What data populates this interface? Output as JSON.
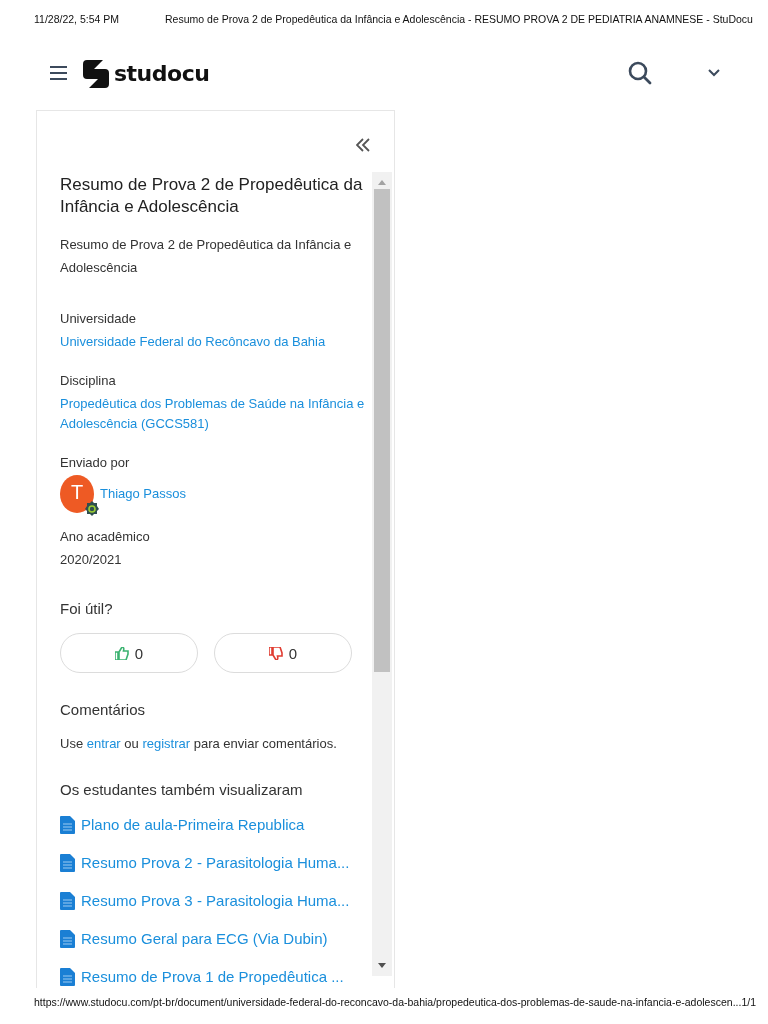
{
  "print_header": {
    "date": "11/28/22, 5:54 PM",
    "title": "Resumo de Prova 2 de Propedêutica da Infância e Adolescência - RESUMO PROVA 2 DE PEDIATRIA ANAMNESE - StuDocu"
  },
  "nav": {
    "logo": "studocu"
  },
  "document": {
    "title": "Resumo de Prova 2 de Propedêutica da Infância e Adolescência",
    "description": "Resumo de Prova 2 de Propedêutica da Infância e Adolescência",
    "fields": [
      {
        "label": "Universidade",
        "value": "Universidade Federal do Recôncavo da Bahia",
        "kind": "link"
      },
      {
        "label": "Disciplina",
        "value": "Propedêutica dos Problemas de Saúde na Infância e Adolescência (GCCS581)",
        "kind": "link"
      },
      {
        "label": "Enviado por",
        "value": "Thiago Passos",
        "kind": "user",
        "avatar_letter": "T"
      },
      {
        "label": "Ano acadêmico",
        "value": "2020/2021",
        "kind": "text"
      }
    ]
  },
  "feedback": {
    "question": "Foi útil?",
    "likes": "0",
    "dislikes": "0"
  },
  "comments": {
    "heading": "Comentários",
    "prompt": [
      {
        "text": "Use ",
        "kind": "text"
      },
      {
        "text": "entrar",
        "kind": "link"
      },
      {
        "text": " ou ",
        "kind": "text"
      },
      {
        "text": "registrar",
        "kind": "link"
      },
      {
        "text": " para enviar comentários.",
        "kind": "text"
      }
    ]
  },
  "related": {
    "heading": "Os estudantes também visualizaram",
    "items": [
      "Plano de aula-Primeira Republica",
      "Resumo Prova 2 - Parasitologia Huma...",
      "Resumo Prova 3 - Parasitologia Huma...",
      "Resumo Geral para ECG (Via Dubin)",
      "Resumo de Prova 1 de Propedêutica ..."
    ]
  },
  "print_footer": {
    "url": "https://www.studocu.com/pt-br/document/universidade-federal-do-reconcavo-da-bahia/propedeutica-dos-problemas-de-saude-na-infancia-e-adolescen...",
    "page": "1/1"
  }
}
